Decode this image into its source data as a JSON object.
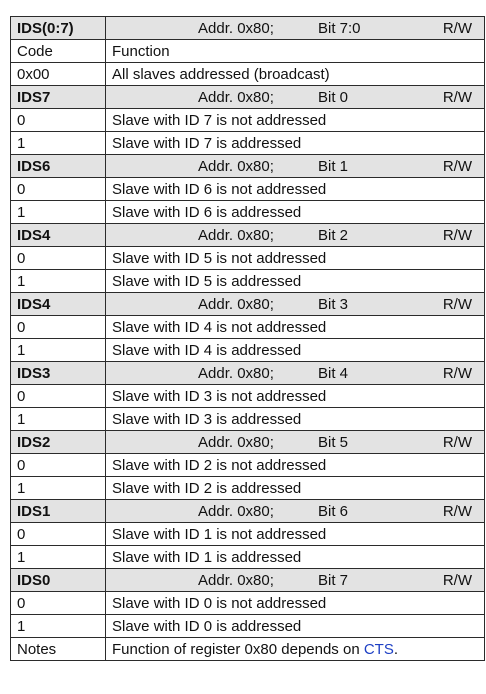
{
  "table": {
    "header_row": {
      "name": "IDS(0:7)",
      "addr": "Addr. 0x80;",
      "bit": "Bit 7:0",
      "rw": "R/W"
    },
    "columns": {
      "code": "Code",
      "function": "Function"
    },
    "broadcast": {
      "code": "0x00",
      "function": "All slaves addressed (broadcast)"
    },
    "sections": [
      {
        "name": "IDS7",
        "addr": "Addr. 0x80;",
        "bit": "Bit 0",
        "rw": "R/W",
        "rows": [
          {
            "code": "0",
            "function": "Slave with ID 7 is not addressed"
          },
          {
            "code": "1",
            "function": "Slave with ID 7 is addressed"
          }
        ]
      },
      {
        "name": "IDS6",
        "addr": "Addr. 0x80;",
        "bit": "Bit 1",
        "rw": "R/W",
        "rows": [
          {
            "code": "0",
            "function": "Slave with ID 6 is not addressed"
          },
          {
            "code": "1",
            "function": "Slave with ID 6 is addressed"
          }
        ]
      },
      {
        "name": "IDS4",
        "addr": "Addr. 0x80;",
        "bit": "Bit 2",
        "rw": "R/W",
        "rows": [
          {
            "code": "0",
            "function": "Slave with ID 5 is not addressed"
          },
          {
            "code": "1",
            "function": "Slave with ID 5 is addressed"
          }
        ]
      },
      {
        "name": "IDS4",
        "addr": "Addr. 0x80;",
        "bit": "Bit 3",
        "rw": "R/W",
        "rows": [
          {
            "code": "0",
            "function": "Slave with ID 4 is not addressed"
          },
          {
            "code": "1",
            "function": "Slave with ID 4 is addressed"
          }
        ]
      },
      {
        "name": "IDS3",
        "addr": "Addr. 0x80;",
        "bit": "Bit 4",
        "rw": "R/W",
        "rows": [
          {
            "code": "0",
            "function": "Slave with ID 3 is not addressed"
          },
          {
            "code": "1",
            "function": "Slave with ID 3 is addressed"
          }
        ]
      },
      {
        "name": "IDS2",
        "addr": "Addr. 0x80;",
        "bit": "Bit 5",
        "rw": "R/W",
        "rows": [
          {
            "code": "0",
            "function": "Slave with ID 2 is not addressed"
          },
          {
            "code": "1",
            "function": "Slave with ID 2 is addressed"
          }
        ]
      },
      {
        "name": "IDS1",
        "addr": "Addr. 0x80;",
        "bit": "Bit 6",
        "rw": "R/W",
        "rows": [
          {
            "code": "0",
            "function": "Slave with ID 1 is not addressed"
          },
          {
            "code": "1",
            "function": "Slave with ID 1 is addressed"
          }
        ]
      },
      {
        "name": "IDS0",
        "addr": "Addr. 0x80;",
        "bit": "Bit 7",
        "rw": "R/W",
        "rows": [
          {
            "code": "0",
            "function": "Slave with ID 0 is not addressed"
          },
          {
            "code": "1",
            "function": "Slave with ID 0 is addressed"
          }
        ]
      }
    ],
    "notes": {
      "label": "Notes",
      "text": "Function of register 0x80 depends on ",
      "link": "CTS",
      "suffix": "."
    },
    "colors": {
      "header_bg": "#e3e3e3",
      "border": "#2b2b2b",
      "link": "#1d3fc4"
    }
  }
}
